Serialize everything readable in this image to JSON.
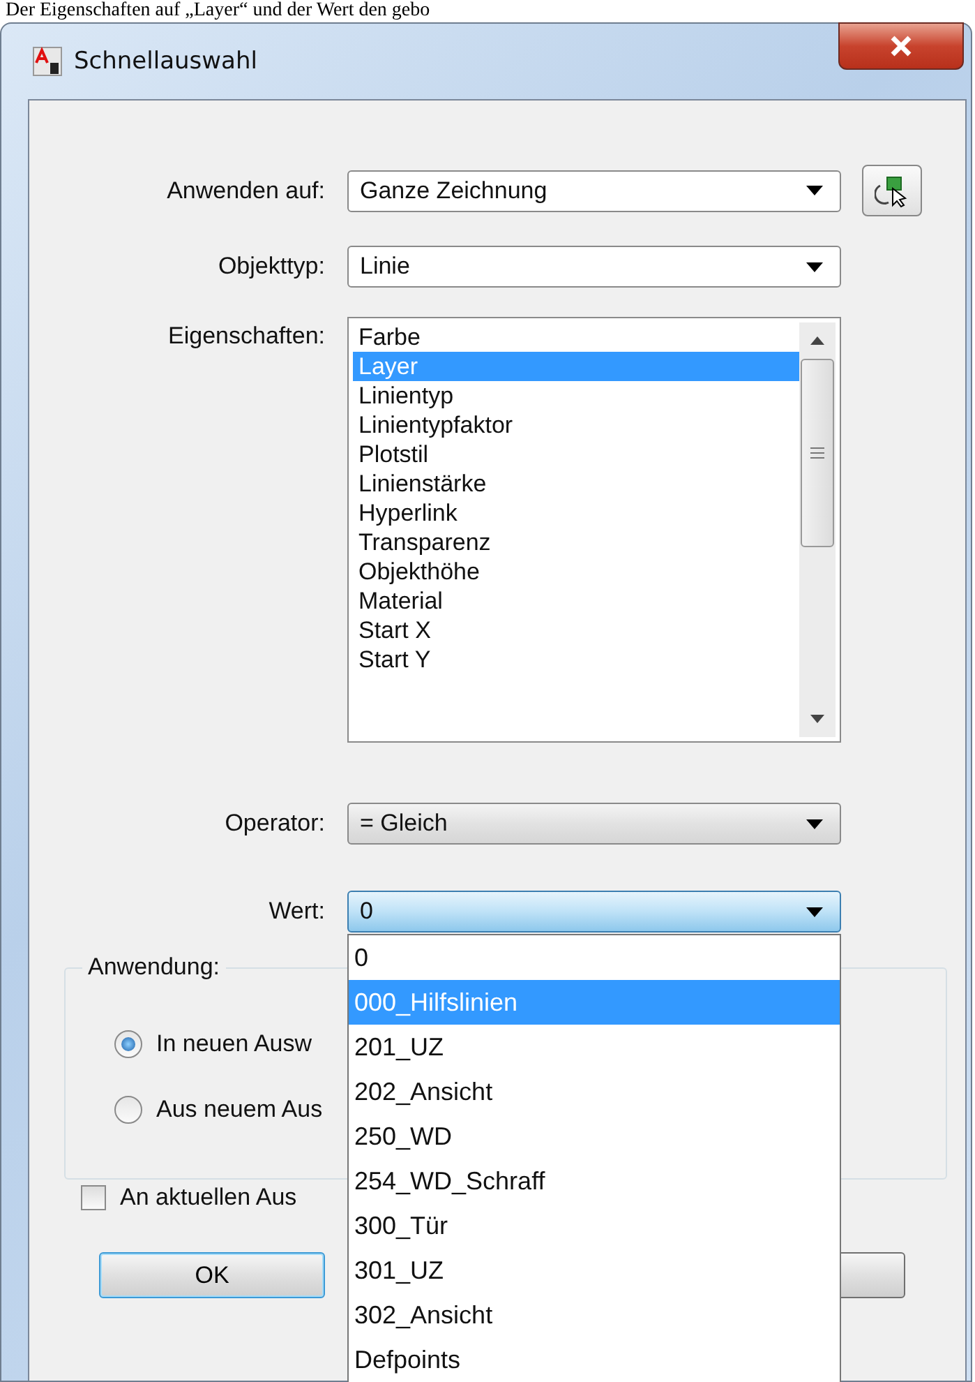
{
  "doc_text": "Der Eigenschaften auf „Layer“ und der Wert den gebo",
  "window": {
    "title": "Schnellauswahl"
  },
  "fields": [
    {
      "label": "Anwenden auf:",
      "value": "Ganze Zeichnung"
    },
    {
      "label": "Objekttyp:",
      "value": "Linie"
    }
  ],
  "properties": {
    "label": "Eigenschaften:",
    "items": [
      {
        "text": "Farbe",
        "selected": false
      },
      {
        "text": "Layer",
        "selected": true
      },
      {
        "text": "Linientyp",
        "selected": false
      },
      {
        "text": "Linientypfaktor",
        "selected": false
      },
      {
        "text": "Plotstil",
        "selected": false
      },
      {
        "text": "Linienstärke",
        "selected": false
      },
      {
        "text": "Hyperlink",
        "selected": false
      },
      {
        "text": "Transparenz",
        "selected": false
      },
      {
        "text": "Objekthöhe",
        "selected": false
      },
      {
        "text": "Material",
        "selected": false
      },
      {
        "text": "Start X",
        "selected": false
      },
      {
        "text": "Start Y",
        "selected": false
      }
    ]
  },
  "operator": {
    "label": "Operator:",
    "value": "= Gleich"
  },
  "value_field": {
    "label": "Wert:",
    "value": "0",
    "expanded": true,
    "options": [
      {
        "text": "0",
        "highlighted": false
      },
      {
        "text": "000_Hilfslinien",
        "highlighted": true
      },
      {
        "text": "201_UZ",
        "highlighted": false
      },
      {
        "text": "202_Ansicht",
        "highlighted": false
      },
      {
        "text": "250_WD",
        "highlighted": false
      },
      {
        "text": "254_WD_Schraff",
        "highlighted": false
      },
      {
        "text": "300_Tür",
        "highlighted": false
      },
      {
        "text": "301_UZ",
        "highlighted": false
      },
      {
        "text": "302_Ansicht",
        "highlighted": false
      },
      {
        "text": "Defpoints",
        "highlighted": false
      }
    ]
  },
  "group": {
    "title": "Anwendung:",
    "options": [
      {
        "label": "In neuen Ausw",
        "selected": true
      },
      {
        "label": "Aus neuem Aus",
        "selected": false
      }
    ]
  },
  "append": {
    "label": "An aktuellen Aus",
    "checked": false
  },
  "ok_button": {
    "label": "OK"
  }
}
